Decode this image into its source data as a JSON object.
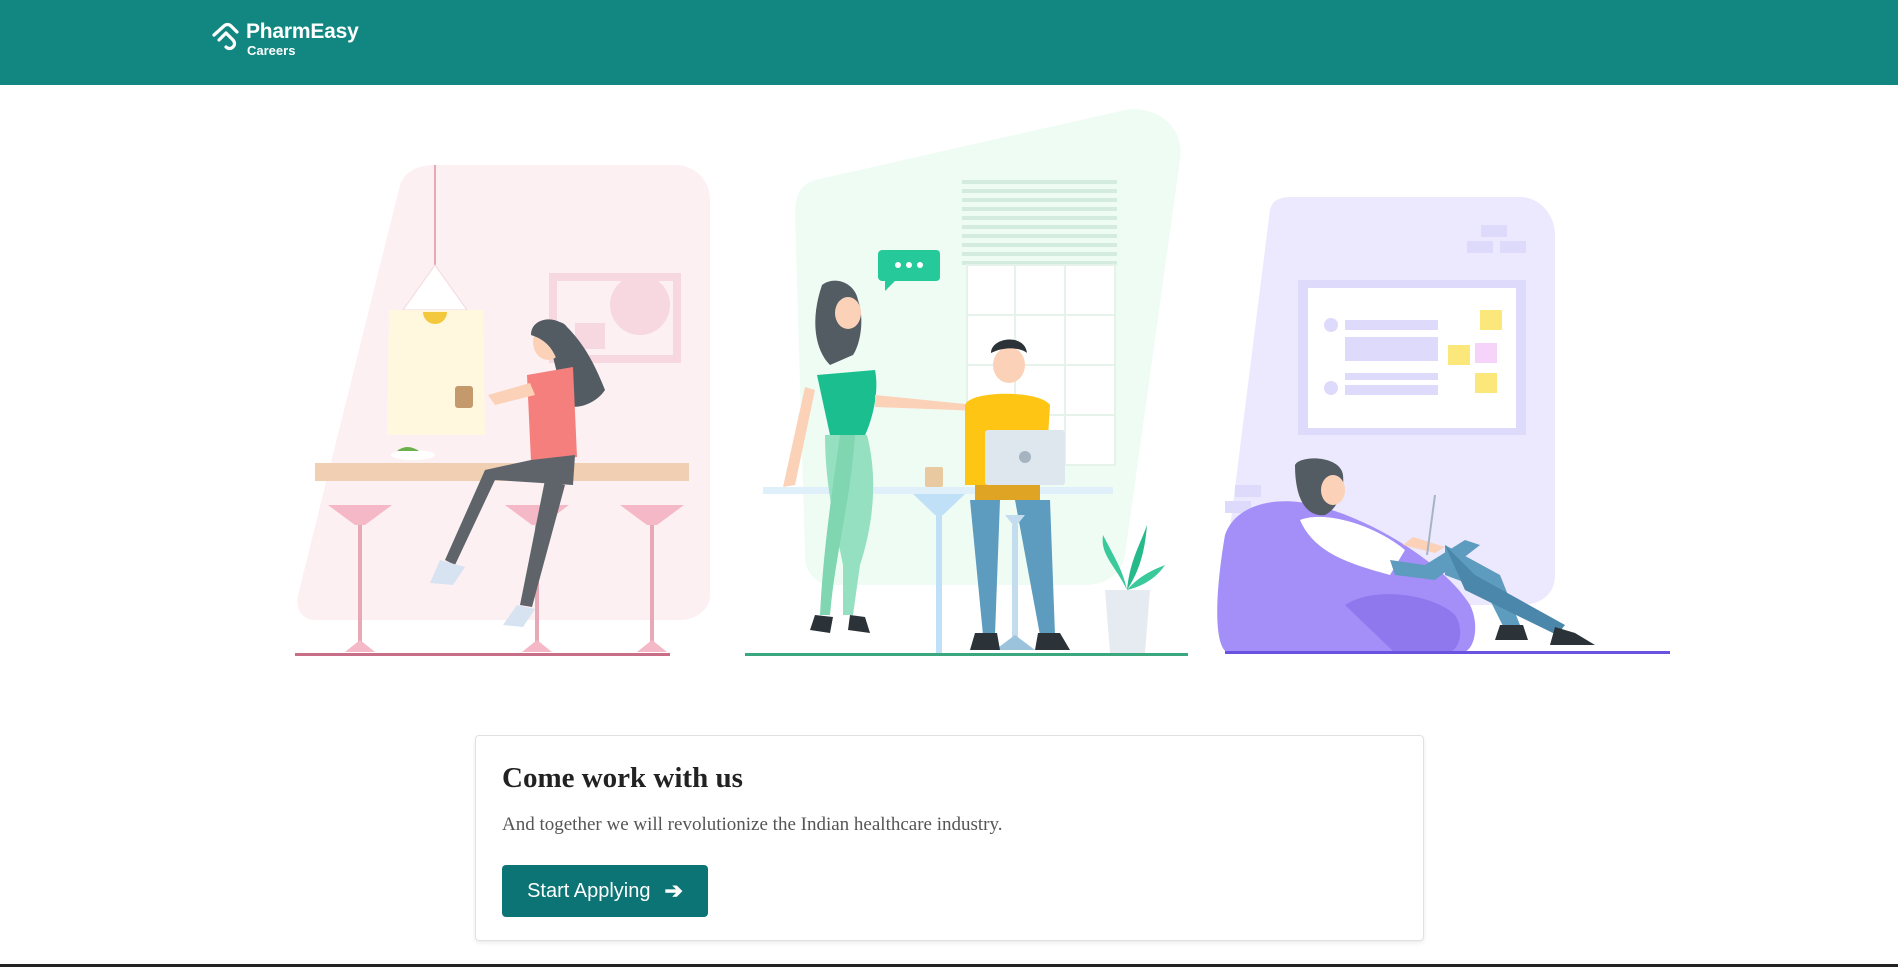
{
  "header": {
    "brand": "PharmEasy",
    "subtitle": "Careers",
    "logo_icon": "pharmeasy-logo-icon",
    "background": "#128781"
  },
  "hero": {
    "illustration": "office-team-illustration",
    "accents": [
      "#fbeef1",
      "#effcf4",
      "#ece8fd"
    ]
  },
  "card": {
    "title": "Come work with us",
    "subtitle": "And together we will revolutionize the Indian healthcare industry.",
    "button_label": "Start Applying",
    "button_icon": "arrow-right-icon",
    "button_color": "#0c7475"
  }
}
